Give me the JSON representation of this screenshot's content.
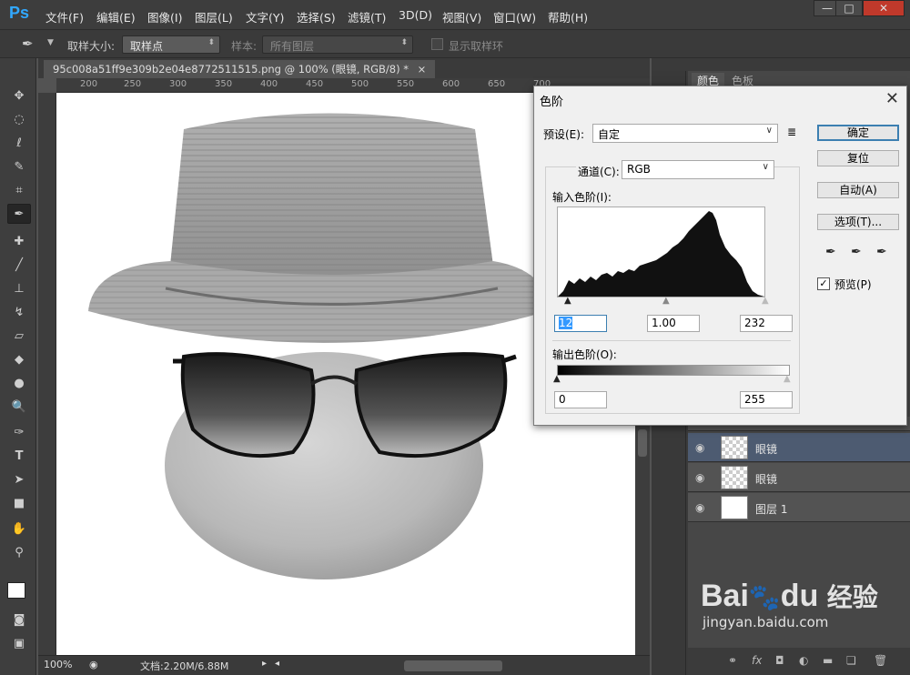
{
  "app": {
    "logo": "Ps"
  },
  "menu": [
    "文件(F)",
    "编辑(E)",
    "图像(I)",
    "图层(L)",
    "文字(Y)",
    "选择(S)",
    "滤镜(T)",
    "3D(D)",
    "视图(V)",
    "窗口(W)",
    "帮助(H)"
  ],
  "window_buttons": {
    "minimize": "—",
    "maximize": "□",
    "close": "✕"
  },
  "options": {
    "sample_size_label": "取样大小:",
    "sample_size_value": "取样点",
    "sample_label": "样本:",
    "sample_value": "所有图层",
    "show_ring_label": "显示取样环"
  },
  "document": {
    "tab_title": "95c008a51ff9e309b2e04e8772511515.png @ 100% (眼镜, RGB/8) *",
    "tab_close": "×",
    "ruler_ticks": [
      "200",
      "250",
      "300",
      "350",
      "400",
      "450",
      "500",
      "550",
      "600",
      "650",
      "700"
    ]
  },
  "status": {
    "zoom": "100%",
    "doc_size": "文档:2.20M/6.88M"
  },
  "right_panel": {
    "tabs": [
      "颜色",
      "色板"
    ],
    "layers": [
      {
        "name": "眼镜",
        "selected": true
      },
      {
        "name": "眼镜",
        "selected": false
      },
      {
        "name": "图层 1",
        "selected": false
      }
    ],
    "footer_icons": [
      "link-icon",
      "fx-icon",
      "mask-icon",
      "adjustment-icon",
      "folder-icon",
      "new-layer-icon",
      "trash-icon"
    ]
  },
  "levels_dialog": {
    "title": "色阶",
    "close": "✕",
    "preset_label": "预设(E):",
    "preset_value": "自定",
    "channel_label": "通道(C):",
    "channel_value": "RGB",
    "input_levels_label": "输入色阶(I):",
    "input_black": "12",
    "input_gamma": "1.00",
    "input_white": "232",
    "output_levels_label": "输出色阶(O):",
    "output_black": "0",
    "output_white": "255",
    "buttons": {
      "ok": "确定",
      "reset": "复位",
      "auto": "自动(A)",
      "options": "选项(T)..."
    },
    "preview_label": "预览(P)",
    "preview_checked": true
  },
  "watermark": {
    "brand": "Bai",
    "brand2": "du",
    "cn": "经验",
    "url": "jingyan.baidu.com"
  }
}
